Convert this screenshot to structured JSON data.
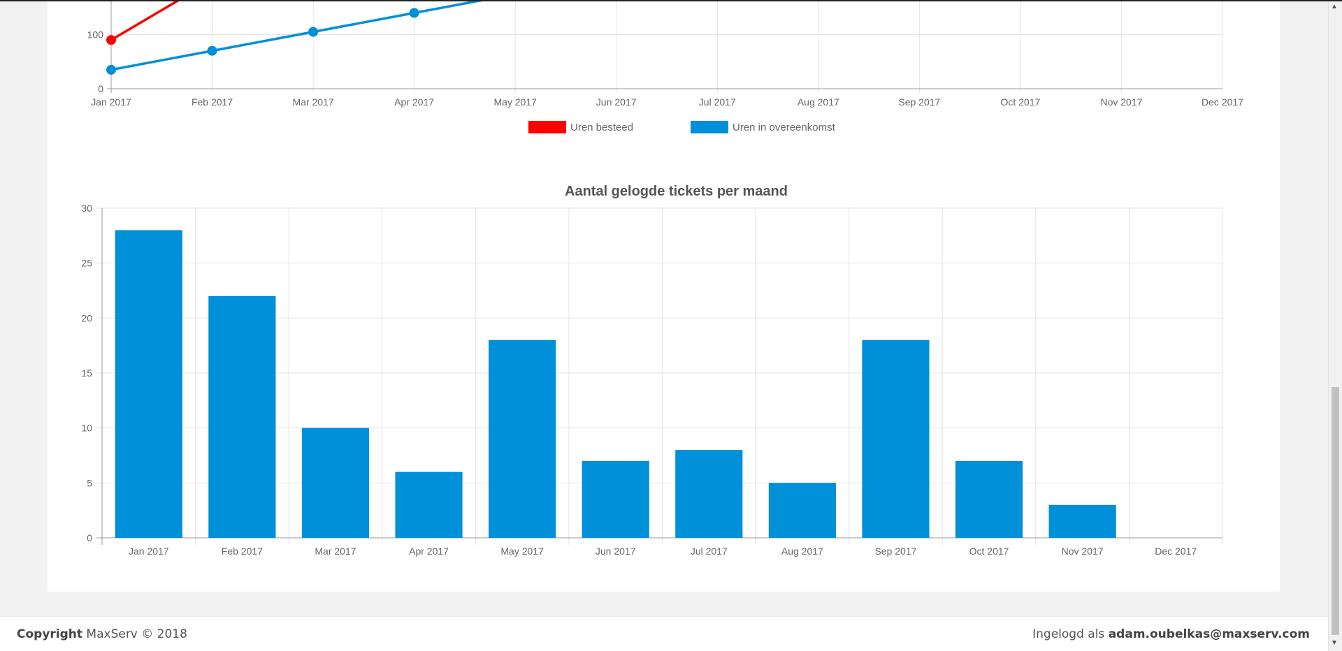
{
  "chart_data": [
    {
      "type": "line",
      "title": "",
      "categories": [
        "Jan 2017",
        "Feb 2017",
        "Mar 2017",
        "Apr 2017",
        "May 2017",
        "Jun 2017",
        "Jul 2017",
        "Aug 2017",
        "Sep 2017",
        "Oct 2017",
        "Nov 2017",
        "Dec 2017"
      ],
      "y_ticks_visible": [
        0,
        100
      ],
      "legend": "bottom-center",
      "series": [
        {
          "name": "Uren besteed",
          "color": "#ff0000",
          "values": [
            90,
            200
          ]
        },
        {
          "name": "Uren in overeenkomst",
          "color": "#0090d9",
          "values": [
            35,
            70,
            105,
            140,
            175
          ]
        }
      ]
    },
    {
      "type": "bar",
      "title": "Aantal gelogde tickets per maand",
      "categories": [
        "Jan 2017",
        "Feb 2017",
        "Mar 2017",
        "Apr 2017",
        "May 2017",
        "Jun 2017",
        "Jul 2017",
        "Aug 2017",
        "Sep 2017",
        "Oct 2017",
        "Nov 2017",
        "Dec 2017"
      ],
      "values": [
        28,
        22,
        10,
        6,
        18,
        7,
        8,
        5,
        18,
        7,
        3,
        0
      ],
      "ylim": [
        0,
        30
      ],
      "y_ticks": [
        0,
        5,
        10,
        15,
        20,
        25,
        30
      ],
      "color": "#0090d9",
      "grid": true
    }
  ],
  "footer": {
    "copyright_bold": "Copyright",
    "copyright_rest": " MaxServ © 2018",
    "login_prefix": "Ingelogd als ",
    "login_user": "adam.oubelkas@maxserv.com"
  },
  "scrollbar": {
    "up_icon": "scroll-up-arrow-icon",
    "down_icon": "scroll-down-arrow-icon"
  }
}
